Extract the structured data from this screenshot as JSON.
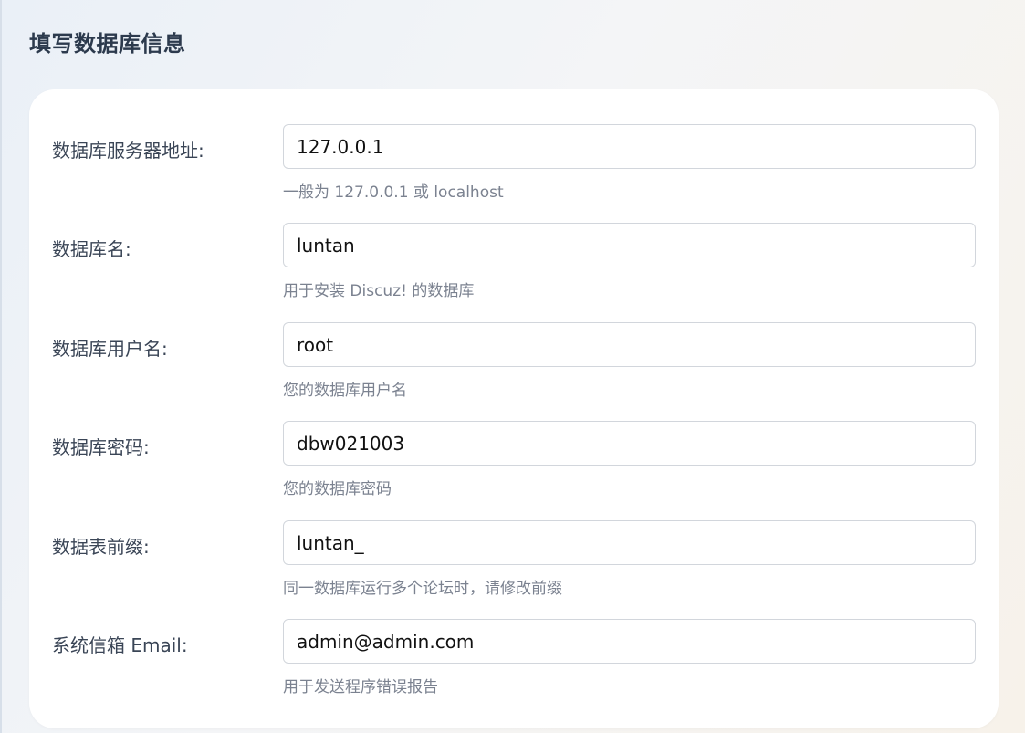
{
  "section": {
    "title": "填写数据库信息"
  },
  "fields": [
    {
      "label": "数据库服务器地址:",
      "value": "127.0.0.1",
      "hint": "一般为 127.0.0.1 或 localhost"
    },
    {
      "label": "数据库名:",
      "value": "luntan",
      "hint": "用于安装 Discuz! 的数据库"
    },
    {
      "label": "数据库用户名:",
      "value": "root",
      "hint": "您的数据库用户名"
    },
    {
      "label": "数据库密码:",
      "value": "dbw021003",
      "hint": "您的数据库密码"
    },
    {
      "label": "数据表前缀:",
      "value": "luntan_",
      "hint": "同一数据库运行多个论坛时，请修改前缀"
    },
    {
      "label": "系统信箱 Email:",
      "value": "admin@admin.com",
      "hint": "用于发送程序错误报告"
    }
  ]
}
